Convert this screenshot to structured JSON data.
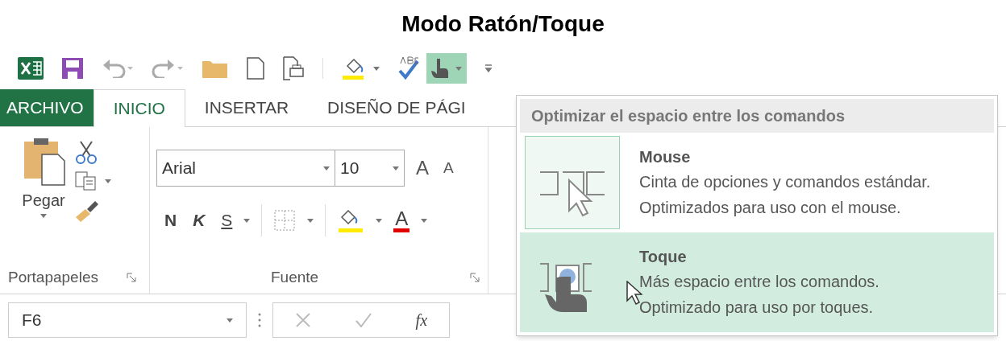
{
  "title": "Modo Ratón/Toque",
  "tabs": [
    {
      "label": "ARCHIVO",
      "kind": "file",
      "selected": false
    },
    {
      "label": "INICIO",
      "kind": "tab",
      "selected": true
    },
    {
      "label": "INSERTAR",
      "kind": "tab",
      "selected": false
    },
    {
      "label": "DISEÑO DE PÁGI",
      "kind": "tab",
      "selected": false
    }
  ],
  "clipboard": {
    "paste": "Pegar",
    "label": "Portapapeles"
  },
  "font": {
    "name": "Arial",
    "size": "10",
    "grow": "A",
    "shrink": "A",
    "bold": "N",
    "italic": "K",
    "underline": "S",
    "font_color": "A",
    "label": "Fuente"
  },
  "formula_bar": {
    "name_box": "F6",
    "fx": "fx"
  },
  "menu": {
    "header": "Optimizar el espacio entre los comandos",
    "options": [
      {
        "kind": "mouse",
        "title": "Mouse",
        "lines": [
          "Cinta de opciones y comandos estándar.",
          "Optimizados para uso con el mouse."
        ],
        "selected": false
      },
      {
        "kind": "touch",
        "title": "Toque",
        "lines": [
          "Más espacio entre los comandos.",
          "Optimizado para uso por toques."
        ],
        "selected": true
      }
    ]
  }
}
